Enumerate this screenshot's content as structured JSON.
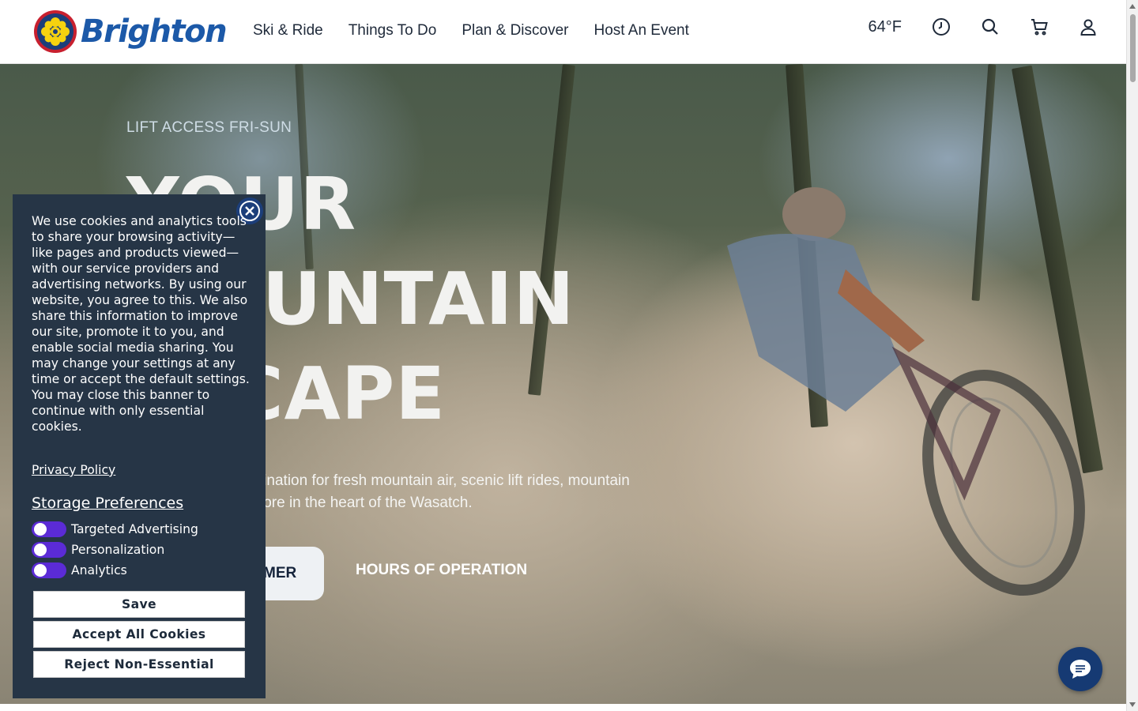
{
  "header": {
    "brand": "Brighton",
    "nav": [
      "Ski & Ride",
      "Things To Do",
      "Plan & Discover",
      "Host An Event"
    ],
    "temperature": "64°F",
    "icons": [
      "clock-icon",
      "search-icon",
      "cart-icon",
      "account-icon"
    ]
  },
  "hero": {
    "eyebrow": "LIFT ACCESS FRI-SUN",
    "headline": [
      "YOUR",
      "MOUNTAIN",
      "ESCAPE"
    ],
    "lead": "Brighton is your destination for fresh mountain air, scenic lift rides, mountain biking, hiking, and more in the heart of the Wasatch.",
    "primary_button": "EXPLORE SUMMER",
    "secondary_button": "HOURS OF OPERATION"
  },
  "cookie_banner": {
    "text": "We use cookies and analytics tools to share your browsing activity—like pages and products viewed—with our service providers and advertising networks. By using our website, you agree to this. We also share this information to improve our site, promote it to you, and enable social media sharing. You may change your settings at any time or accept the default settings. You may close this banner to continue with only essential cookies.",
    "privacy_link": "Privacy Policy",
    "storage_title": "Storage Preferences",
    "preferences": [
      "Targeted Advertising",
      "Personalization",
      "Analytics"
    ],
    "buttons": {
      "save": "Save",
      "accept": "Accept All Cookies",
      "reject": "Reject Non-Essential"
    }
  },
  "colors": {
    "brand_blue": "#1c59a8",
    "banner_bg": "#263546",
    "toggle_purple": "#5b2bd6",
    "chat_blue": "#163a73"
  }
}
